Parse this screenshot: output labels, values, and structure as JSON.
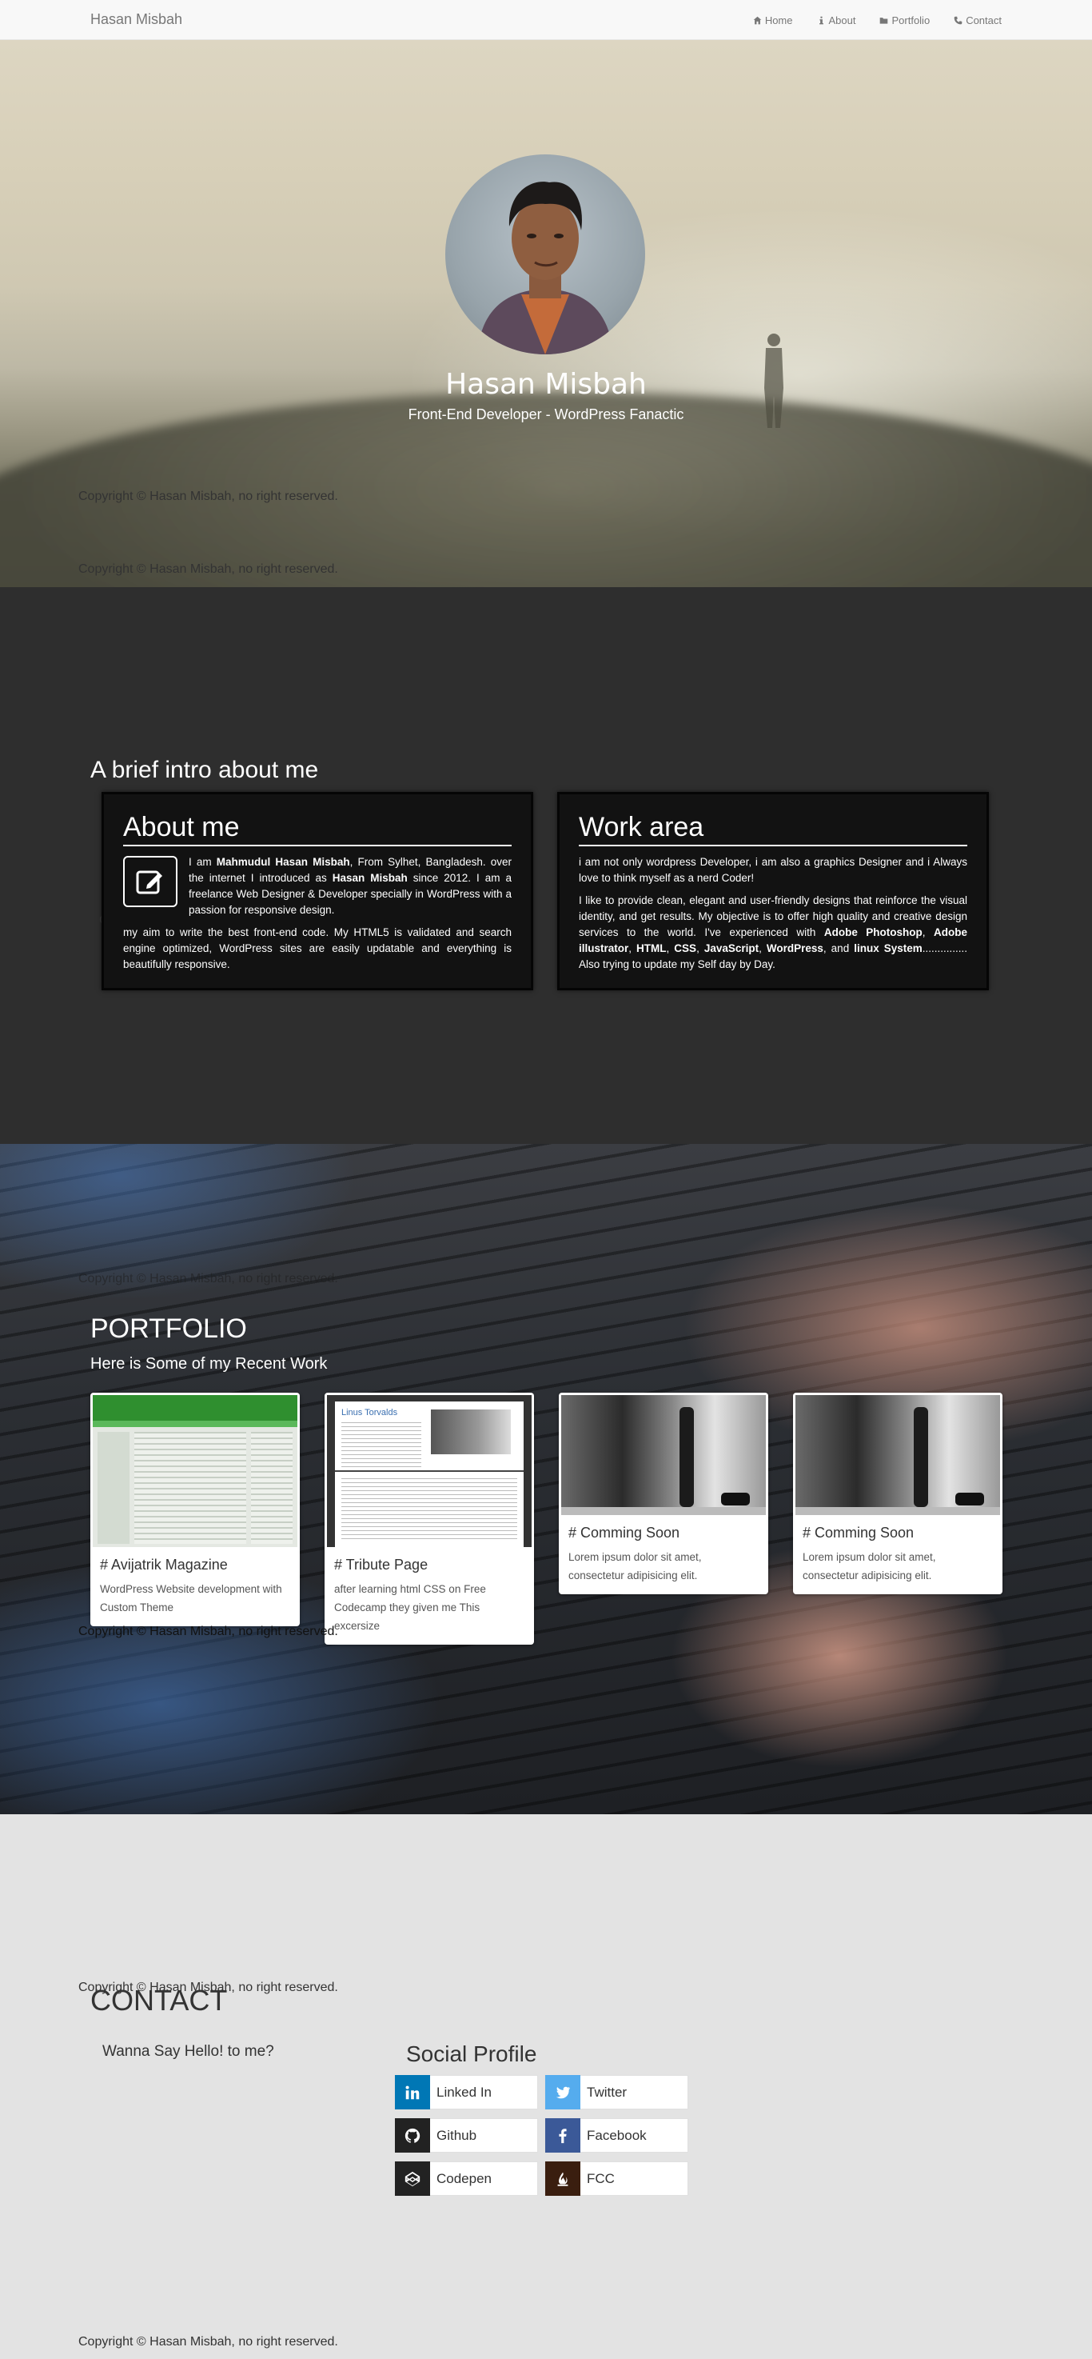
{
  "nav": {
    "brand": "Hasan Misbah",
    "items": [
      {
        "label": "Home",
        "icon": "home-icon"
      },
      {
        "label": "About",
        "icon": "info-icon"
      },
      {
        "label": "Portfolio",
        "icon": "folder-icon"
      },
      {
        "label": "Contact",
        "icon": "phone-icon"
      }
    ]
  },
  "hero": {
    "name": "Hasan Misbah",
    "subtitle": "Front-End Developer - WordPress Fanactic"
  },
  "footer": {
    "copyright": "Copyright © Hasan Misbah, no right reserved."
  },
  "about": {
    "heading": "A brief intro about me",
    "about_card": {
      "title": "About me",
      "p1_a": "I am ",
      "p1_name": "Mahmudul Hasan Misbah",
      "p1_b": ", From Sylhet, Bangladesh. over the internet I introduced as ",
      "p1_alias": "Hasan Misbah",
      "p1_c": " since 2012. I am a freelance Web Designer & Developer specially in WordPress with a passion for responsive design.",
      "p2": "my aim to write the best front-end code. My HTML5 is validated and search engine optimized, WordPress sites are easily updatable and everything is beautifully responsive."
    },
    "work_card": {
      "title": "Work area",
      "p1": "i am not only wordpress Developer, i am also a graphics Designer and i Always love to think myself as a nerd Coder!",
      "p2_a": "I like to provide clean, elegant and user-friendly designs that reinforce the visual identity, and get results. My objective is to offer high quality and creative design services to the world. I've experienced with ",
      "skills": [
        "Adobe Photoshop",
        "Adobe illustrator",
        "HTML",
        "CSS",
        "JavaScript",
        "WordPress"
      ],
      "sep": ", ",
      "and": ", and ",
      "last_skill": "linux System",
      "p2_end": "............... Also trying to update my Self day by Day."
    }
  },
  "portfolio": {
    "title": "PORTFOLIO",
    "subtitle": "Here is Some of my Recent Work",
    "cards": [
      {
        "title": "# Avijatrik Magazine",
        "text": "WordPress Website development with Custom Theme"
      },
      {
        "title": "# Tribute Page",
        "text": "after learning html CSS on Free Codecamp they given me This excersize"
      },
      {
        "title": "# Comming Soon",
        "text": "Lorem ipsum dolor sit amet, consectetur adipisicing elit."
      },
      {
        "title": "# Comming Soon",
        "text": "Lorem ipsum dolor sit amet, consectetur adipisicing elit."
      }
    ],
    "tribute_thumb_heading": "Linus Torvalds"
  },
  "contact": {
    "title": "CONTACT",
    "hello": "Wanna Say Hello! to me?",
    "social_title": "Social Profile",
    "links": [
      {
        "label": "Linked In",
        "icon": "linkedin-icon",
        "color": "#0077b5"
      },
      {
        "label": "Twitter",
        "icon": "twitter-icon",
        "color": "#55acee"
      },
      {
        "label": "Github",
        "icon": "github-icon",
        "color": "#222222"
      },
      {
        "label": "Facebook",
        "icon": "facebook-icon",
        "color": "#3b5998"
      },
      {
        "label": "Codepen",
        "icon": "codepen-icon",
        "color": "#222222"
      },
      {
        "label": "FCC",
        "icon": "fcc-icon",
        "color": "#3a1e0f"
      }
    ]
  }
}
